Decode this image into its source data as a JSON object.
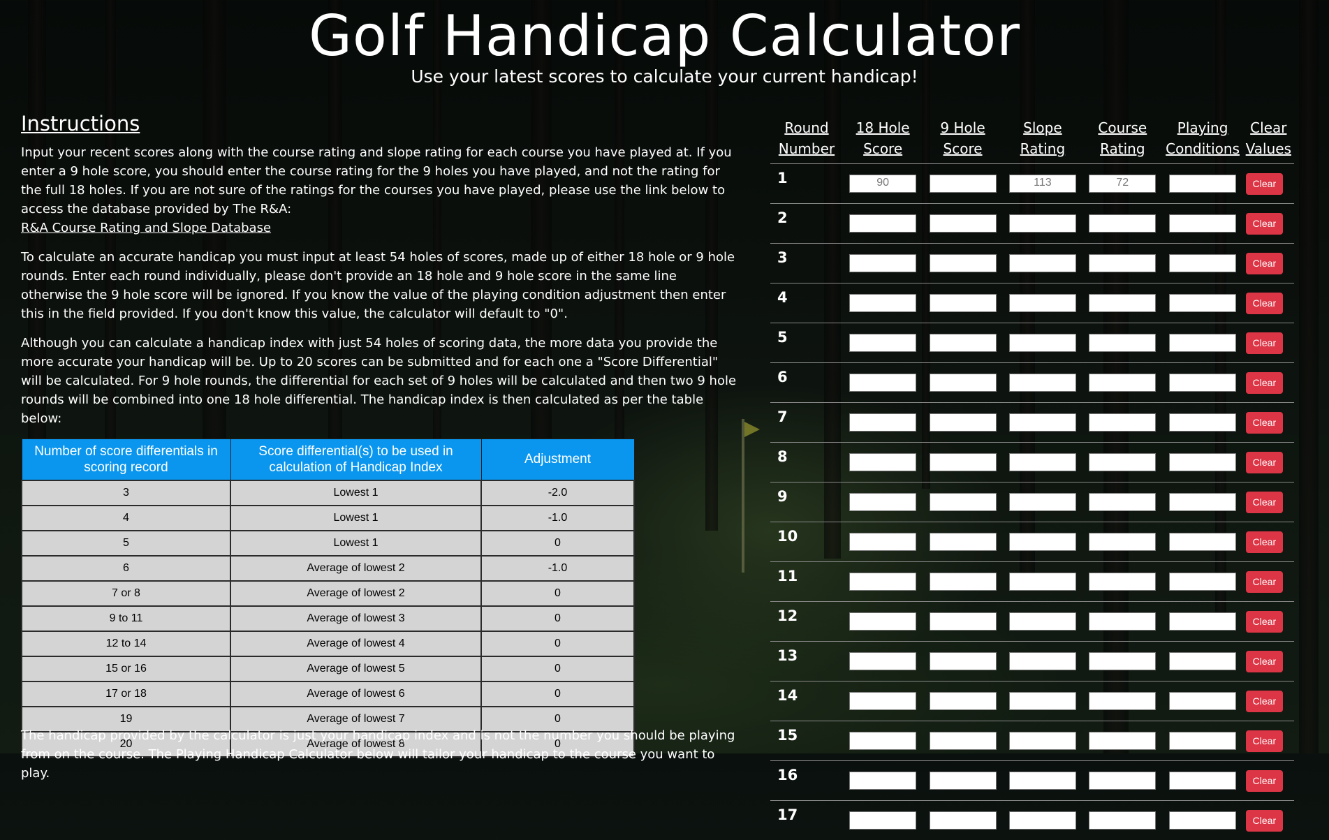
{
  "page": {
    "title": "Golf Handicap Calculator",
    "subtitle": "Use your latest scores to calculate your current handicap!"
  },
  "instructions": {
    "heading": "Instructions",
    "para1": "Input your recent scores along with the course rating and slope rating for each course you have played at. If you enter a 9 hole score, you should enter the course rating for the 9 holes you have played, and not the rating for the full 18 holes. If you are not sure of the ratings for the courses you have played, please use the link below to access the database provided by The R&A:",
    "link": "R&A Course Rating and Slope Database",
    "para2": "To calculate an accurate handicap you must input at least 54 holes of scores, made up of either 18 hole or 9 hole rounds. Enter each round individually, please don't provide an 18 hole and 9 hole score in the same line otherwise the 9 hole score will be ignored. If you know the value of the playing condition adjustment then enter this in the field provided. If you don't know this value, the calculator will default to \"0\".",
    "para3": "Although you can calculate a handicap index with just 54 holes of scoring data, the more data you provide the more accurate your handicap will be. Up to 20 scores can be submitted and for each one a \"Score Differential\" will be calculated. For 9 hole rounds, the differential for each set of 9 holes will be calculated and then two 9 hole rounds will be combined into one 18 hole differential. The handicap index is then calculated as per the table below:",
    "note": "The handicap provided by the calculator is just your handicap index and is not the number you should be playing from on the course. The Playing Handicap Calculator below will tailor your handicap to the course you want to play."
  },
  "handicap_table": {
    "headers": [
      "Number of score differentials in scoring record",
      "Score differential(s) to be used in calculation of Handicap Index",
      "Adjustment"
    ],
    "rows": [
      [
        "3",
        "Lowest 1",
        "-2.0"
      ],
      [
        "4",
        "Lowest 1",
        "-1.0"
      ],
      [
        "5",
        "Lowest 1",
        "0"
      ],
      [
        "6",
        "Average of lowest 2",
        "-1.0"
      ],
      [
        "7 or 8",
        "Average of lowest 2",
        "0"
      ],
      [
        "9 to 11",
        "Average of lowest 3",
        "0"
      ],
      [
        "12 to 14",
        "Average of lowest 4",
        "0"
      ],
      [
        "15 or 16",
        "Average of lowest 5",
        "0"
      ],
      [
        "17 or 18",
        "Average of lowest 6",
        "0"
      ],
      [
        "19",
        "Average of lowest 7",
        "0"
      ],
      [
        "20",
        "Average of lowest 8",
        "0"
      ]
    ]
  },
  "rounds": {
    "headers": {
      "round": [
        "Round",
        "Number"
      ],
      "h18": [
        "18 Hole",
        "Score"
      ],
      "h9": [
        "9 Hole",
        "Score"
      ],
      "slope": [
        "Slope",
        "Rating"
      ],
      "course": [
        "Course",
        "Rating"
      ],
      "playing": [
        "Playing",
        "Conditions"
      ],
      "clear": [
        "Clear",
        "Values"
      ]
    },
    "placeholders": {
      "h18": "90",
      "h9": "",
      "slope": "113",
      "course": "72",
      "playing": ""
    },
    "clear_label": "Clear",
    "rows": [
      "1",
      "2",
      "3",
      "4",
      "5",
      "6",
      "7",
      "8",
      "9",
      "10",
      "11",
      "12",
      "13",
      "14",
      "15",
      "16",
      "17"
    ]
  },
  "colors": {
    "table_header": "#0a96ee",
    "table_cell": "#d4d4d4",
    "clear_button": "#dc3545",
    "text": "#ffffff"
  }
}
